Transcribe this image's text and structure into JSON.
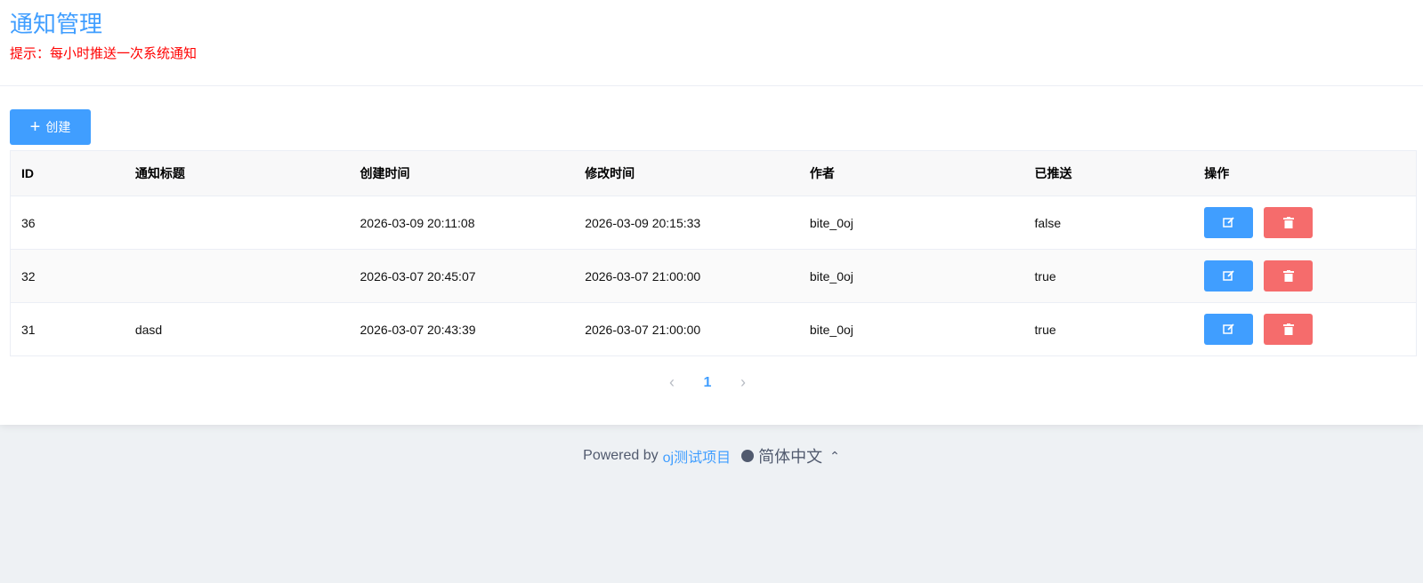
{
  "header": {
    "title": "通知管理",
    "hint": "提示：每小时推送一次系统通知"
  },
  "toolbar": {
    "create_label": "创建"
  },
  "table": {
    "columns": [
      "ID",
      "通知标题",
      "创建时间",
      "修改时间",
      "作者",
      "已推送",
      "操作"
    ],
    "rows": [
      {
        "id": "36",
        "title": "",
        "created": "2026-03-09 20:11:08",
        "modified": "2026-03-09 20:15:33",
        "author": "bite_0oj",
        "pushed": "false"
      },
      {
        "id": "32",
        "title": "",
        "created": "2026-03-07 20:45:07",
        "modified": "2026-03-07 21:00:00",
        "author": "bite_0oj",
        "pushed": "true"
      },
      {
        "id": "31",
        "title": "dasd",
        "created": "2026-03-07 20:43:39",
        "modified": "2026-03-07 21:00:00",
        "author": "bite_0oj",
        "pushed": "true"
      }
    ]
  },
  "pagination": {
    "current_page": "1",
    "prev_icon": "chevron-left-icon",
    "next_icon": "chevron-right-icon"
  },
  "footer": {
    "powered_by": "Powered by",
    "project_link": "oj测试项目",
    "language": "简体中文"
  },
  "colors": {
    "primary": "#409eff",
    "danger": "#f56c6c",
    "hint": "#ff0000",
    "background": "#eef1f4"
  }
}
